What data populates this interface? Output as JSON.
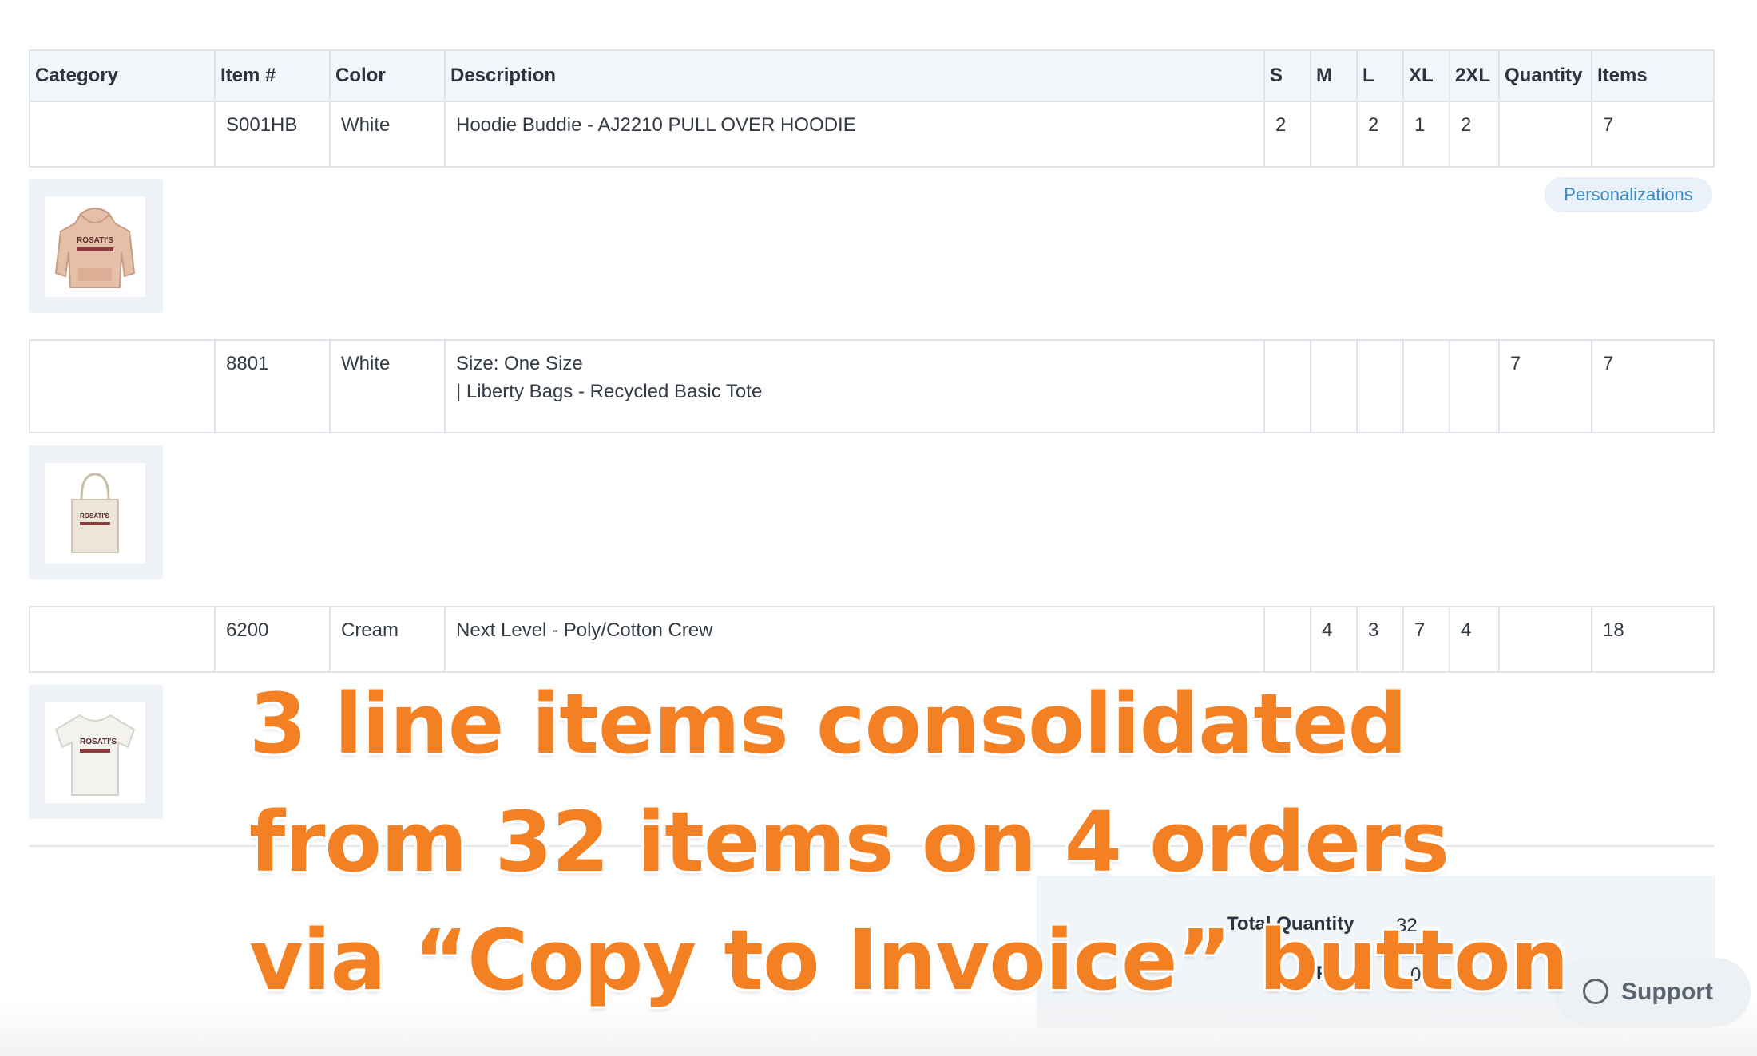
{
  "table": {
    "headers": [
      "Category",
      "Item #",
      "Color",
      "Description",
      "S",
      "M",
      "L",
      "XL",
      "2XL",
      "Quantity",
      "Items"
    ],
    "rows": [
      {
        "category": "",
        "item": "S001HB",
        "color": "White",
        "description": "Hoodie Buddie - AJ2210 PULL OVER HOODIE",
        "description2": "",
        "s": "2",
        "m": "",
        "l": "2",
        "xl": "1",
        "xxl": "2",
        "quantity": "",
        "items": "7",
        "product_icon": "hoodie-icon"
      },
      {
        "category": "",
        "item": "8801",
        "color": "White",
        "description": "Size: One Size",
        "description2": "| Liberty Bags - Recycled Basic Tote",
        "s": "",
        "m": "",
        "l": "",
        "xl": "",
        "xxl": "",
        "quantity": "7",
        "items": "7",
        "product_icon": "tote-bag-icon"
      },
      {
        "category": "",
        "item": "6200",
        "color": "Cream",
        "description": "Next Level - Poly/Cotton Crew",
        "description2": "",
        "s": "",
        "m": "4",
        "l": "3",
        "xl": "7",
        "xxl": "4",
        "quantity": "",
        "items": "18",
        "product_icon": "tshirt-icon"
      }
    ]
  },
  "product_graphic_text": "ROSATI'S",
  "personalizations_label": "Personalizations",
  "totals": {
    "quantity_label": "Total Quantity",
    "quantity_value": "32",
    "second_label": "F",
    "second_value": "0"
  },
  "support_label": "Support",
  "overlay": {
    "line1": "3 line items consolidated",
    "line2": "from 32 items on 4 orders",
    "line3": "via “Copy to Invoice” button"
  },
  "colors": {
    "accent": "#f48024",
    "link": "#3a8cc6",
    "header_bg": "#f2f5f9",
    "border": "#dfe4ea"
  }
}
